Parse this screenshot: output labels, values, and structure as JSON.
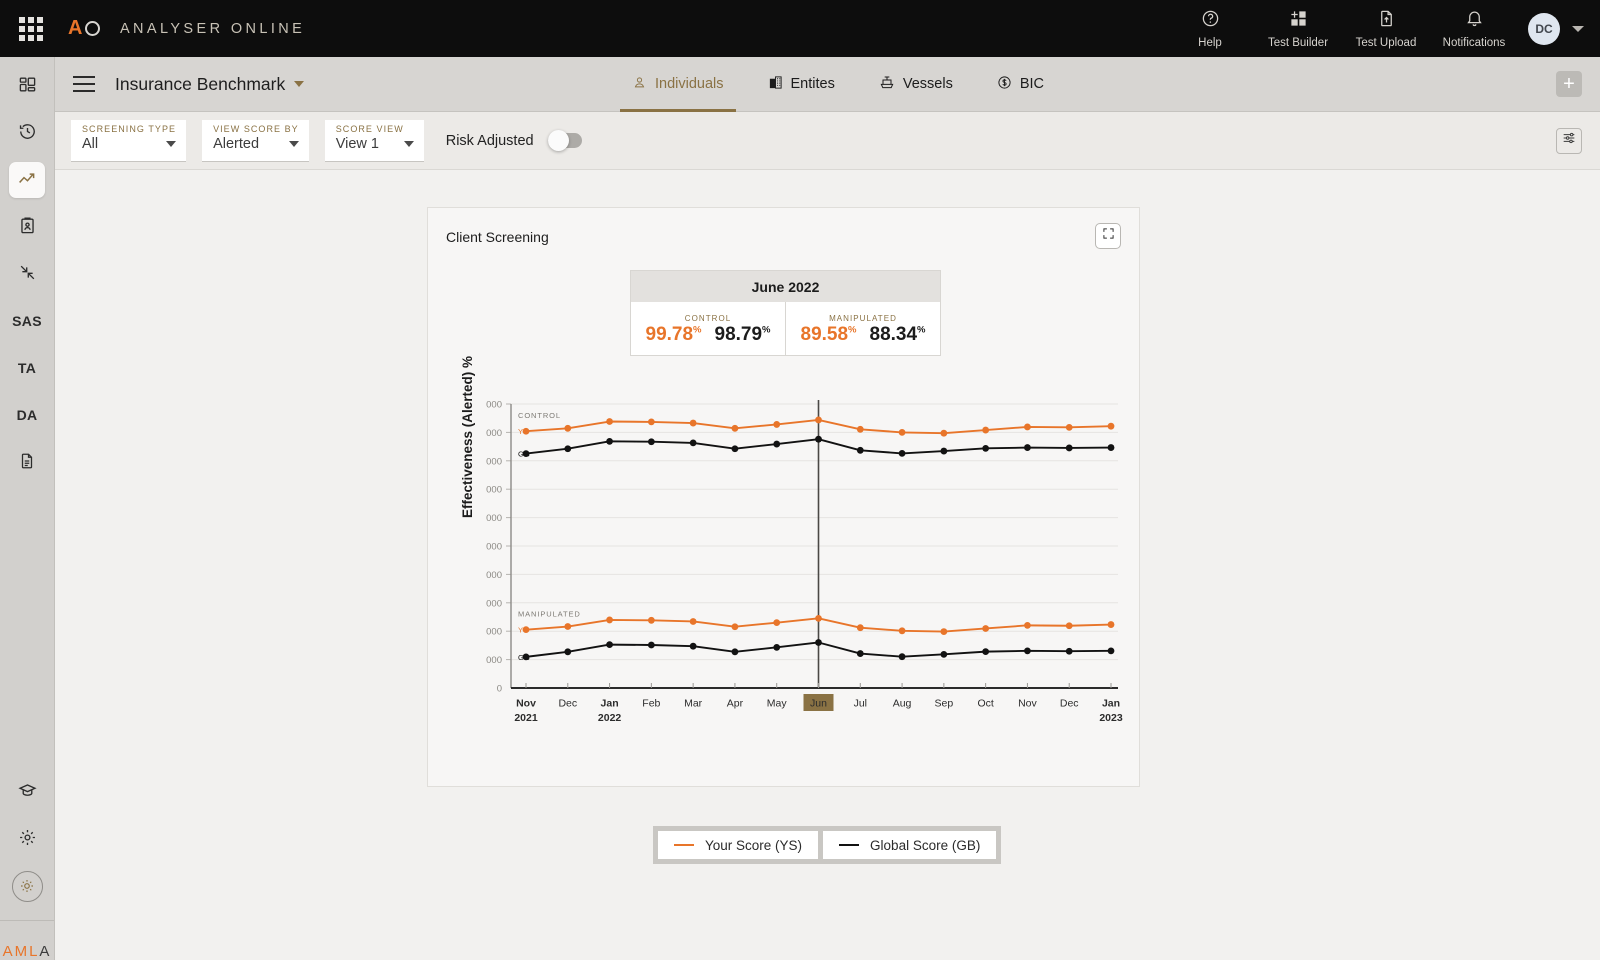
{
  "topbar": {
    "apps_icon": "apps-grid-icon",
    "logo_a": "A",
    "brand": "ANALYSER ONLINE",
    "items": [
      {
        "label": "Help",
        "icon": "help-circle-icon"
      },
      {
        "label": "Test Builder",
        "icon": "test-builder-icon"
      },
      {
        "label": "Test Upload",
        "icon": "file-upload-icon"
      },
      {
        "label": "Notifications",
        "icon": "bell-icon"
      }
    ],
    "avatar_initials": "DC"
  },
  "sidebar": {
    "items": [
      {
        "name": "dashboard",
        "icon": "dashboard-grid-icon",
        "text": "",
        "active": false
      },
      {
        "name": "history",
        "icon": "history-clock-icon",
        "text": "",
        "active": false
      },
      {
        "name": "trends",
        "icon": "trending-up-icon",
        "text": "",
        "active": true
      },
      {
        "name": "reports",
        "icon": "clipboard-person-icon",
        "text": "",
        "active": false
      },
      {
        "name": "collapse",
        "icon": "collapse-arrows-icon",
        "text": "",
        "active": false
      },
      {
        "name": "sas",
        "icon": "text-icon",
        "text": "SAS",
        "active": false
      },
      {
        "name": "ta",
        "icon": "text-icon",
        "text": "TA",
        "active": false
      },
      {
        "name": "da",
        "icon": "text-icon",
        "text": "DA",
        "active": false
      },
      {
        "name": "documents",
        "icon": "document-icon",
        "text": "",
        "active": false
      }
    ],
    "bottom_items": [
      {
        "name": "learning",
        "icon": "graduation-cap-icon"
      },
      {
        "name": "settings",
        "icon": "gear-icon"
      },
      {
        "name": "brightness",
        "icon": "brightness-sun-icon"
      }
    ],
    "footer_logo_orange": "AML",
    "footer_logo_dark": "A"
  },
  "subheader": {
    "menu_icon": "hamburger-icon",
    "project_title": "Insurance Benchmark",
    "tabs": [
      {
        "label": "Individuals",
        "icon": "person-icon",
        "active": true
      },
      {
        "label": "Entites",
        "icon": "building-icon",
        "active": false
      },
      {
        "label": "Vessels",
        "icon": "vessel-icon",
        "active": false
      },
      {
        "label": "BIC",
        "icon": "dollar-circle-icon",
        "active": false
      }
    ],
    "add_label": "+"
  },
  "filters": [
    {
      "label": "SCREENING TYPE",
      "value": "All"
    },
    {
      "label": "VIEW SCORE BY",
      "value": "Alerted"
    },
    {
      "label": "SCORE VIEW",
      "value": "View 1"
    }
  ],
  "risk_adjusted": {
    "label": "Risk Adjusted",
    "enabled": false
  },
  "settings_icon": "sliders-icon",
  "card": {
    "title": "Client Screening",
    "expand_icon": "fullscreen-icon",
    "kpi": {
      "period": "June 2022",
      "groups": [
        {
          "caption": "CONTROL",
          "ys": "99.78",
          "gb": "98.79",
          "unit": "%"
        },
        {
          "caption": "MANIPULATED",
          "ys": "89.58",
          "gb": "88.34",
          "unit": "%"
        }
      ]
    }
  },
  "legend": [
    {
      "label": "Your Score (YS)",
      "color": "#e8752a"
    },
    {
      "label": "Global Score (GB)",
      "color": "#121212"
    }
  ],
  "colors": {
    "accent_orange": "#e8752a",
    "accent_brown": "#8a7244",
    "dark": "#121212"
  },
  "chart_data": {
    "type": "line",
    "title": "Client Screening",
    "ylabel": "Effectiveness (Alerted) %",
    "xlabel": "",
    "ytick_labels": [
      "000",
      "000",
      "000",
      "000",
      "000",
      "000",
      "000",
      "000",
      "000",
      "000",
      "0"
    ],
    "grid": true,
    "legend_position": "bottom",
    "highlighted_x": "Jun",
    "highlighted_x_index": 7,
    "x": [
      "Nov",
      "Dec",
      "Jan",
      "Feb",
      "Mar",
      "Apr",
      "May",
      "Jun",
      "Jul",
      "Aug",
      "Sep",
      "Oct",
      "Nov",
      "Dec",
      "Jan"
    ],
    "x_years": [
      "2021",
      "",
      "2022",
      "",
      "",
      "",
      "",
      "",
      "",
      "",
      "",
      "",
      "",
      "",
      "2023"
    ],
    "group_labels": [
      "CONTROL",
      "MANIPULATED"
    ],
    "series_short_labels": [
      "YS",
      "GB"
    ],
    "series": [
      {
        "name": "Control - Your Score (YS)",
        "group": "CONTROL",
        "short": "YS",
        "color": "#e8752a",
        "values": [
          99.2,
          99.35,
          99.7,
          99.68,
          99.62,
          99.35,
          99.55,
          99.78,
          99.3,
          99.14,
          99.1,
          99.26,
          99.42,
          99.4,
          99.46
        ]
      },
      {
        "name": "Control - Global Score (GB)",
        "group": "CONTROL",
        "short": "GB",
        "color": "#121212",
        "values": [
          98.05,
          98.3,
          98.68,
          98.66,
          98.6,
          98.3,
          98.54,
          98.79,
          98.22,
          98.06,
          98.18,
          98.32,
          98.36,
          98.34,
          98.36
        ]
      },
      {
        "name": "Manipulated - Your Score (YS)",
        "group": "MANIPULATED",
        "short": "YS",
        "color": "#e8752a",
        "values": [
          89.0,
          89.16,
          89.5,
          89.48,
          89.42,
          89.15,
          89.36,
          89.58,
          89.1,
          88.94,
          88.9,
          89.06,
          89.22,
          89.2,
          89.26
        ]
      },
      {
        "name": "Manipulated - Global Score (GB)",
        "group": "MANIPULATED",
        "short": "GB",
        "color": "#121212",
        "values": [
          87.6,
          87.86,
          88.23,
          88.21,
          88.15,
          87.86,
          88.09,
          88.34,
          87.77,
          87.61,
          87.73,
          87.87,
          87.91,
          87.89,
          87.91
        ]
      }
    ]
  }
}
